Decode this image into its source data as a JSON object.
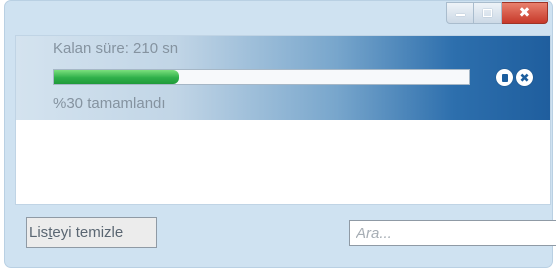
{
  "window": {
    "buttons": {
      "minimize_icon": "minimize-icon",
      "maximize_icon": "maximize-icon",
      "close_icon": "close-icon",
      "close_glyph": "✖"
    }
  },
  "download": {
    "remaining_text": "Kalan süre: 210 sn",
    "progress": 0.3,
    "percent_text": "%30 tamamlandı",
    "pause_icon": "pause-icon",
    "cancel_icon": "cancel-icon",
    "cancel_glyph": "✖"
  },
  "footer": {
    "clear_label_pre": "Lis",
    "clear_label_u": "t",
    "clear_label_post": "eyi temizle",
    "search_placeholder": "Ara..."
  },
  "colors": {
    "accent": "#1f5e9e",
    "progress_green": "#2fb04a",
    "close_red": "#c7392a"
  }
}
